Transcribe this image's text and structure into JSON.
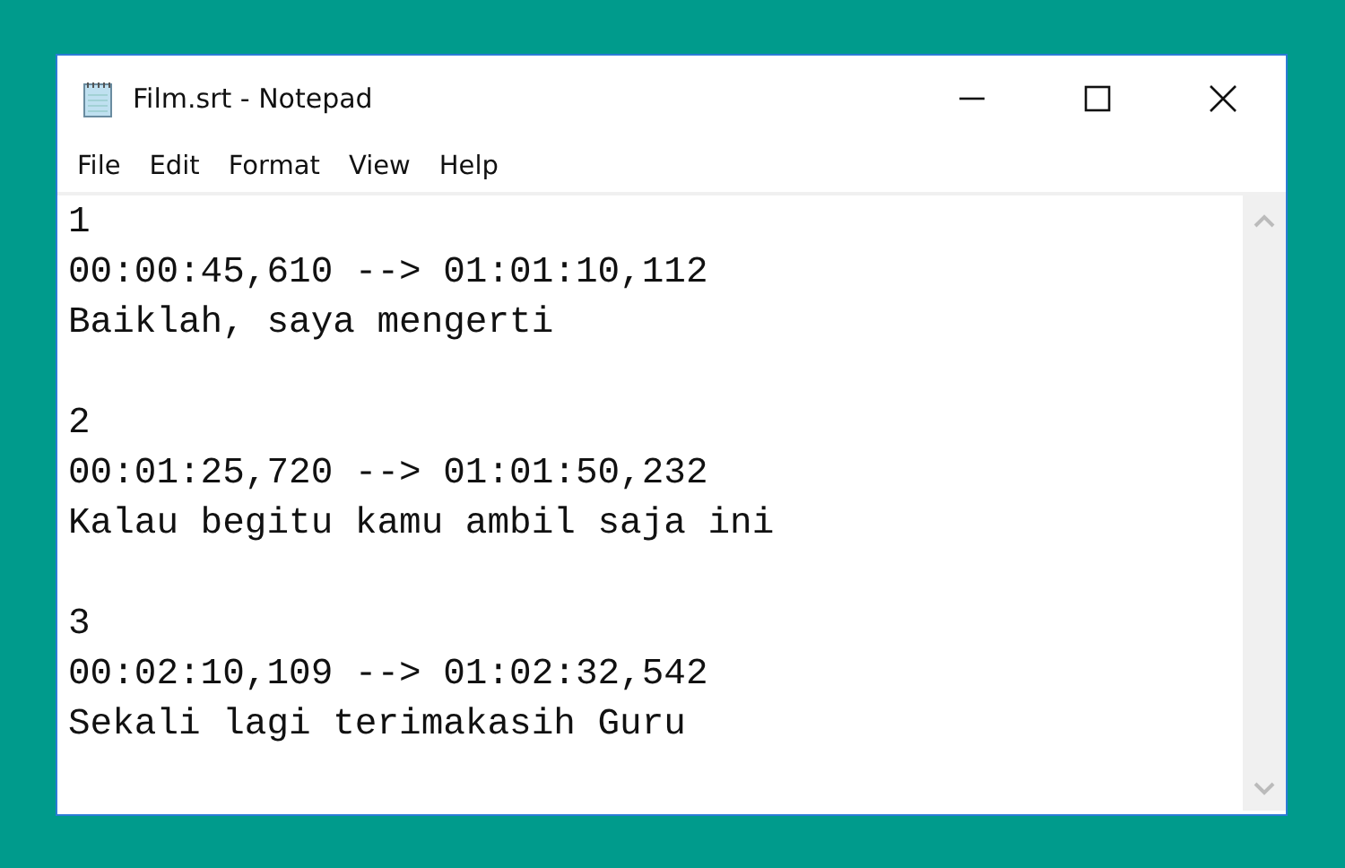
{
  "window": {
    "title": "Film.srt - Notepad"
  },
  "menu": [
    "File",
    "Edit",
    "Format",
    "View",
    "Help"
  ],
  "subtitles": [
    {
      "index": "1",
      "timing": "00:00:45,610 --> 01:01:10,112",
      "text": "Baiklah, saya mengerti"
    },
    {
      "index": "2",
      "timing": "00:01:25,720 --> 01:01:50,232",
      "text": "Kalau begitu kamu ambil saja ini"
    },
    {
      "index": "3",
      "timing": "00:02:10,109 --> 01:02:32,542",
      "text": "Sekali lagi terimakasih Guru"
    }
  ]
}
